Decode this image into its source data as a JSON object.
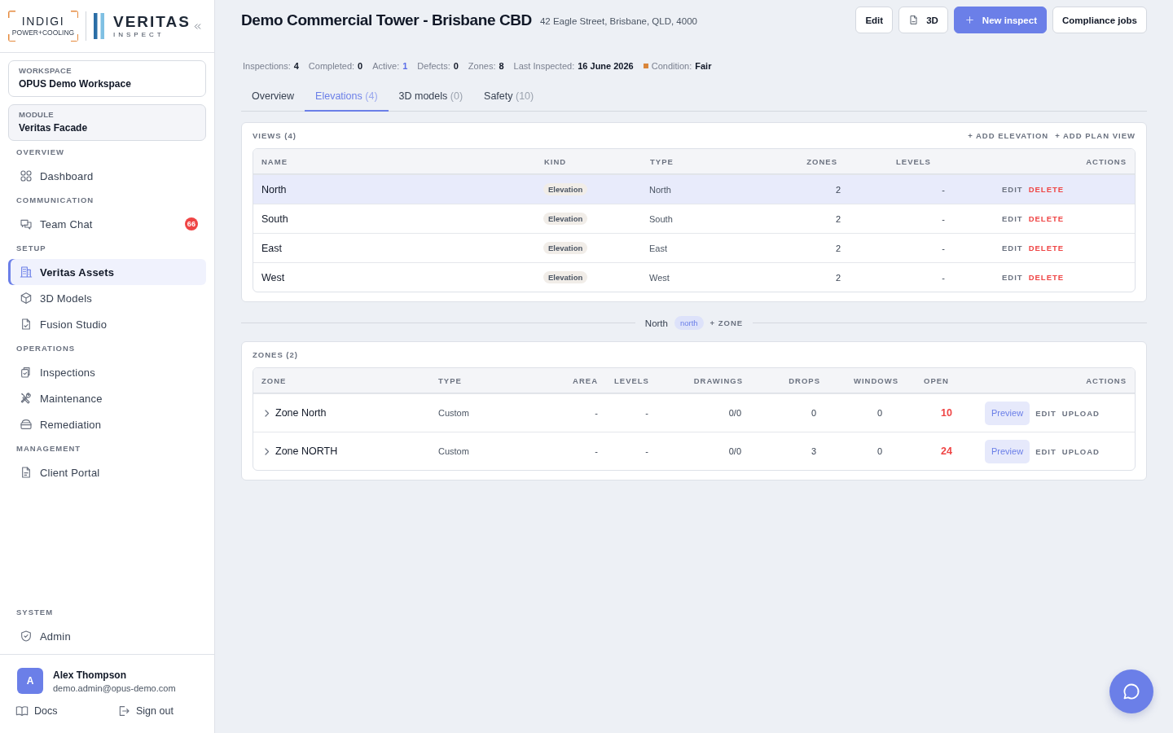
{
  "sidebar": {
    "brand": {
      "name": "INDIGI",
      "tagline": "POWER+COOLING"
    },
    "product": {
      "name": "VERITAS",
      "tagline": "INSPECT"
    },
    "workspace": {
      "label": "WORKSPACE",
      "value": "OPUS Demo Workspace"
    },
    "module": {
      "label": "MODULE",
      "value": "Veritas Facade"
    },
    "sections": [
      {
        "title": "OVERVIEW",
        "items": [
          {
            "label": "Dashboard",
            "selected": false
          }
        ]
      },
      {
        "title": "COMMUNICATION",
        "items": [
          {
            "label": "Team Chat",
            "badge": "66",
            "selected": false
          }
        ]
      },
      {
        "title": "SETUP",
        "items": [
          {
            "label": "Veritas Assets",
            "selected": true
          },
          {
            "label": "3D Models",
            "selected": false
          },
          {
            "label": "Fusion Studio",
            "selected": false
          }
        ]
      },
      {
        "title": "OPERATIONS",
        "items": [
          {
            "label": "Inspections",
            "selected": false
          },
          {
            "label": "Maintenance",
            "selected": false
          },
          {
            "label": "Remediation",
            "selected": false
          }
        ]
      },
      {
        "title": "MANAGEMENT",
        "items": [
          {
            "label": "Client Portal",
            "selected": false
          }
        ]
      }
    ],
    "system_section": {
      "title": "SYSTEM",
      "items": [
        {
          "label": "Admin",
          "selected": false
        }
      ]
    },
    "user": {
      "initial": "A",
      "name": "Alex Thompson",
      "email": "demo.admin@opus-demo.com"
    },
    "footer_links": [
      "Docs",
      "Sign out"
    ]
  },
  "header": {
    "title": "Demo Commercial Tower - Brisbane CBD",
    "address": "42 Eagle Street, Brisbane, QLD, 4000",
    "actions": [
      {
        "label": "Edit",
        "kind": "secondary"
      },
      {
        "label": "3D",
        "kind": "secondary"
      },
      {
        "label": "New inspect",
        "kind": "primary"
      },
      {
        "label": "Compliance jobs",
        "kind": "secondary"
      }
    ],
    "stats": [
      {
        "label": "Inspections:",
        "value": "4",
        "color": "#111827"
      },
      {
        "label": "Completed:",
        "value": "0",
        "color": "#111827"
      },
      {
        "label": "Active:",
        "value": "1",
        "color": "#5b6ee8"
      },
      {
        "label": "Defects:",
        "value": "0",
        "color": "#111827"
      },
      {
        "label": "Zones:",
        "value": "8",
        "color": "#111827"
      },
      {
        "label": "Last Inspected:",
        "value": "16 June 2026",
        "color": "#111827"
      }
    ],
    "condition": {
      "label": "Condition:",
      "value": "Fair",
      "color": "#d9863b"
    }
  },
  "tabs": [
    {
      "label": "Overview",
      "selected": false
    },
    {
      "label": "Elevations",
      "count": "(4)",
      "selected": true
    },
    {
      "label": "3D models",
      "count": "(0)",
      "selected": false
    },
    {
      "label": "Safety",
      "count": "(10)",
      "selected": false
    }
  ],
  "views": {
    "title": "VIEWS (4)",
    "actions": [
      "+ ADD ELEVATION",
      "+ ADD PLAN VIEW"
    ],
    "columns": [
      "NAME",
      "KIND",
      "TYPE",
      "ZONES",
      "LEVELS",
      "ACTIONS"
    ],
    "rows": [
      {
        "name": "North",
        "view_kind": "Elevation",
        "type": "North",
        "zones": "2",
        "levels": "-",
        "selected": true,
        "actions": [
          {
            "label": "EDIT",
            "kind": "neutral"
          },
          {
            "label": "DELETE",
            "kind": "danger"
          }
        ]
      },
      {
        "name": "South",
        "view_kind": "Elevation",
        "type": "South",
        "zones": "2",
        "levels": "-",
        "selected": false,
        "actions": [
          {
            "label": "EDIT",
            "kind": "neutral"
          },
          {
            "label": "DELETE",
            "kind": "danger"
          }
        ]
      },
      {
        "name": "East",
        "view_kind": "Elevation",
        "type": "East",
        "zones": "2",
        "levels": "-",
        "selected": false,
        "actions": [
          {
            "label": "EDIT",
            "kind": "neutral"
          },
          {
            "label": "DELETE",
            "kind": "danger"
          }
        ]
      },
      {
        "name": "West",
        "view_kind": "Elevation",
        "type": "West",
        "zones": "2",
        "levels": "-",
        "selected": false,
        "actions": [
          {
            "label": "EDIT",
            "kind": "neutral"
          },
          {
            "label": "DELETE",
            "kind": "danger"
          }
        ]
      }
    ]
  },
  "zone_bar": {
    "view": "North",
    "tag": "north",
    "action": "+ ZONE"
  },
  "zones": {
    "title": "ZONES (2)",
    "columns": [
      "ZONE",
      "TYPE",
      "AREA",
      "LEVELS",
      "DRAWINGS",
      "DROPS",
      "WINDOWS",
      "OPEN",
      "ACTIONS"
    ],
    "rows": [
      {
        "name": "Zone North",
        "type": "Custom",
        "area": "-",
        "levels": "-",
        "drawings": "0/0",
        "drops": "0",
        "windows": "0",
        "open": "10",
        "expanded": false,
        "actions": [
          {
            "label": "Preview",
            "kind": "button"
          },
          {
            "label": "EDIT",
            "kind": "link"
          },
          {
            "label": "UPLOAD",
            "kind": "link"
          }
        ]
      },
      {
        "name": "Zone NORTH",
        "type": "Custom",
        "area": "-",
        "levels": "-",
        "drawings": "0/0",
        "drops": "3",
        "windows": "0",
        "open": "24",
        "expanded": false,
        "actions": [
          {
            "label": "Preview",
            "kind": "button"
          },
          {
            "label": "EDIT",
            "kind": "link"
          },
          {
            "label": "UPLOAD",
            "kind": "link"
          }
        ]
      }
    ]
  }
}
